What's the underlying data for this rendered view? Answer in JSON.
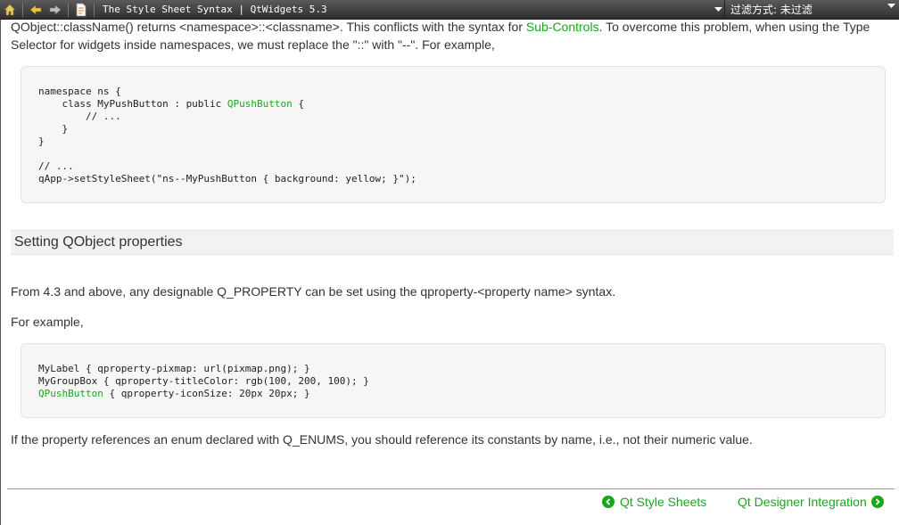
{
  "toolbar": {
    "title": "The Style Sheet Syntax | QtWidgets 5.3",
    "filter_label": "过滤方式: 未过滤"
  },
  "content": {
    "para1_line1_a": "QObject::className() returns <namespace>::<classname>. This conflicts with the syntax for ",
    "para1_link": "Sub-Controls",
    "para1_line1_b": ". To overcome this problem, when using the Type",
    "para1_line2": "Selector for widgets inside namespaces, we must replace the \"::\" with \"--\". For example,",
    "code1": {
      "l1": "namespace ns {",
      "l2a": "    class MyPushButton : public ",
      "l2b": "QPushButton",
      "l2c": " {",
      "l3": "        // ...",
      "l4": "    }",
      "l5": "}",
      "l6": "",
      "l7": "// ...",
      "l8": "qApp->setStyleSheet(\"ns--MyPushButton { background: yellow; }\");"
    },
    "section_title": "Setting QObject properties",
    "para2": "From 4.3 and above, any designable Q_PROPERTY can be set using the qproperty-<property name> syntax.",
    "para3": "For example,",
    "code2": {
      "l1": "MyLabel { qproperty-pixmap: url(pixmap.png); }",
      "l2": "MyGroupBox { qproperty-titleColor: rgb(100, 200, 100); }",
      "l3a": "QPushButton",
      "l3b": " { qproperty-iconSize: 20px 20px; }"
    },
    "para4": "If the property references an enum declared with Q_ENUMS, you should reference its constants by name, i.e., not their numeric value."
  },
  "nav": {
    "prev_label": "Qt Style Sheets",
    "next_label": "Qt Designer Integration"
  },
  "colors": {
    "accent": "#17a81a",
    "toolbar_bg": "#3c3c3c"
  },
  "icons": [
    "home-icon",
    "back-icon",
    "forward-icon",
    "document-icon",
    "chevron-down-icon",
    "chevron-left-icon",
    "chevron-right-icon"
  ]
}
